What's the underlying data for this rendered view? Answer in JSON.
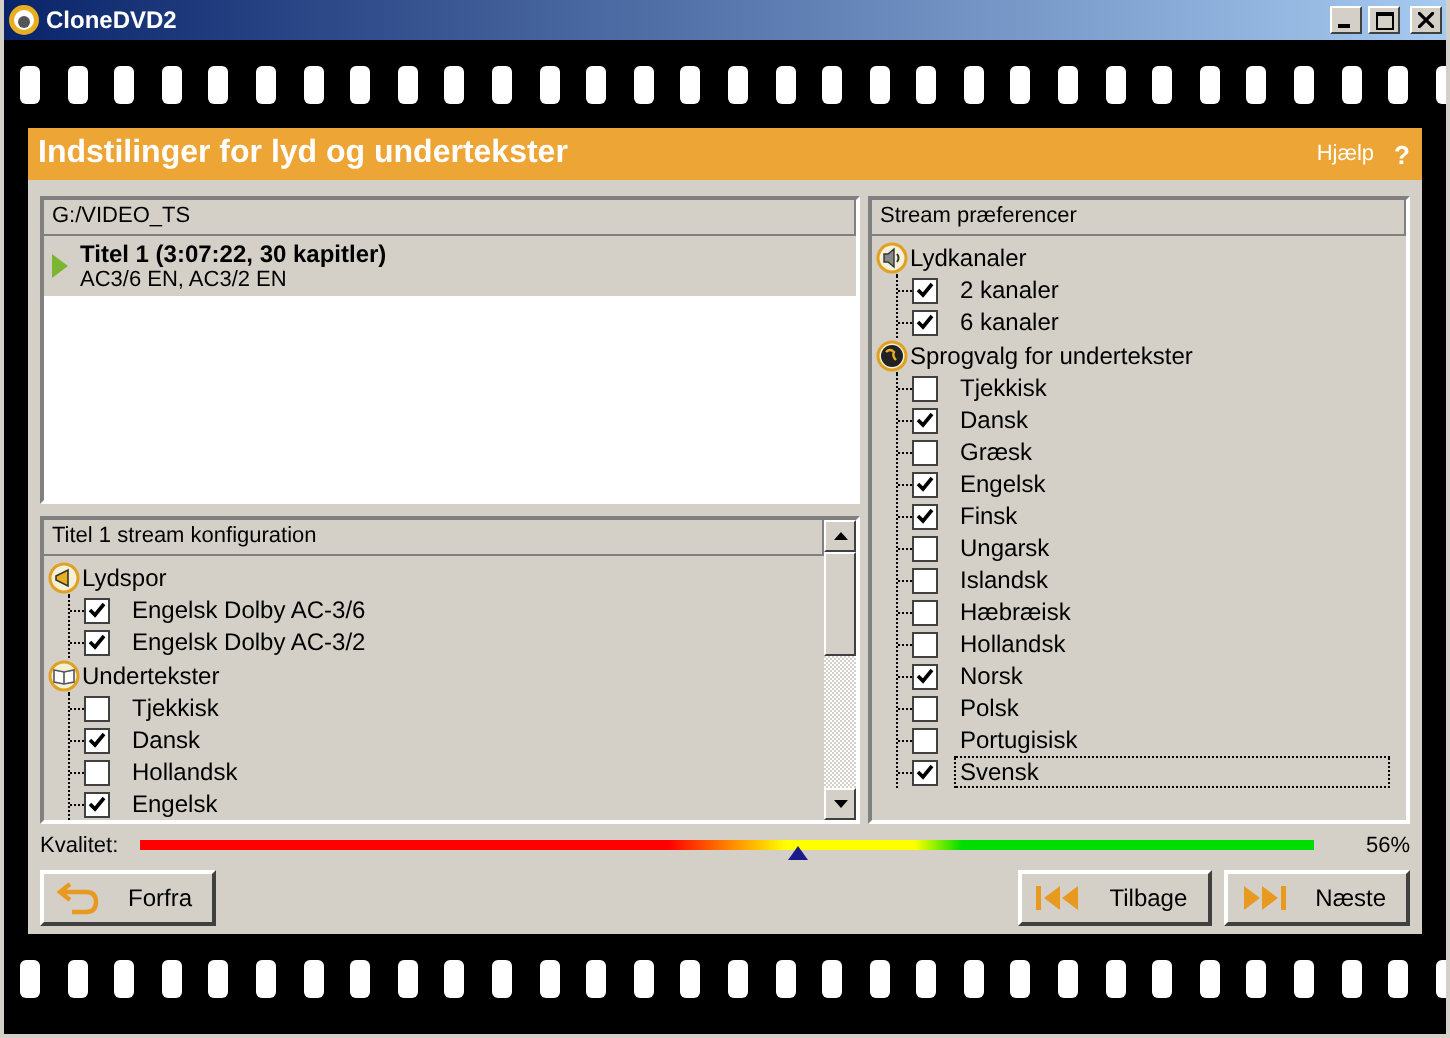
{
  "window": {
    "title": "CloneDVD2"
  },
  "header": {
    "title": "Indstilinger for lyd og undertekster",
    "help": "Hjælp",
    "help_mark": "?"
  },
  "titles_panel": {
    "path": "G:/VIDEO_TS",
    "items": [
      {
        "title": "Titel 1 (3:07:22, 30 kapitler)",
        "subtitle": "AC3/6 EN, AC3/2 EN",
        "selected": true
      }
    ]
  },
  "stream_config": {
    "heading": "Titel 1 stream konfiguration",
    "groups": [
      {
        "kind": "audio",
        "label": "Lydspor",
        "children": [
          {
            "label": "Engelsk Dolby AC-3/6",
            "checked": true,
            "selected": false
          },
          {
            "label": "Engelsk Dolby AC-3/2",
            "checked": true,
            "selected": false
          }
        ]
      },
      {
        "kind": "subtitles",
        "label": "Undertekster",
        "children": [
          {
            "label": "Tjekkisk",
            "checked": false,
            "selected": false
          },
          {
            "label": "Dansk",
            "checked": true,
            "selected": false
          },
          {
            "label": "Hollandsk",
            "checked": false,
            "selected": false
          },
          {
            "label": "Engelsk",
            "checked": true,
            "selected": false
          }
        ]
      }
    ]
  },
  "stream_preferences": {
    "heading": "Stream præferencer",
    "groups": [
      {
        "kind": "channels",
        "label": "Lydkanaler",
        "children": [
          {
            "label": "2 kanaler",
            "checked": true,
            "selected": false
          },
          {
            "label": "6 kanaler",
            "checked": true,
            "selected": false
          }
        ]
      },
      {
        "kind": "languages",
        "label": "Sprogvalg for undertekster",
        "children": [
          {
            "label": "Tjekkisk",
            "checked": false,
            "selected": false
          },
          {
            "label": "Dansk",
            "checked": true,
            "selected": false
          },
          {
            "label": "Græsk",
            "checked": false,
            "selected": false
          },
          {
            "label": "Engelsk",
            "checked": true,
            "selected": false
          },
          {
            "label": "Finsk",
            "checked": true,
            "selected": false
          },
          {
            "label": "Ungarsk",
            "checked": false,
            "selected": false
          },
          {
            "label": "Islandsk",
            "checked": false,
            "selected": false
          },
          {
            "label": "Hæbræisk",
            "checked": false,
            "selected": false
          },
          {
            "label": "Hollandsk",
            "checked": false,
            "selected": false
          },
          {
            "label": "Norsk",
            "checked": true,
            "selected": false
          },
          {
            "label": "Polsk",
            "checked": false,
            "selected": false
          },
          {
            "label": "Portugisisk",
            "checked": false,
            "selected": false
          },
          {
            "label": "Svensk",
            "checked": true,
            "selected": true
          }
        ]
      }
    ]
  },
  "quality": {
    "label": "Kvalitet:",
    "level": 0.56,
    "reading": "56%"
  },
  "buttons": [
    {
      "kind": "restart",
      "label": "Forfra"
    },
    {
      "kind": "back",
      "label": "Tilbage"
    },
    {
      "kind": "next",
      "label": "Næste"
    }
  ]
}
